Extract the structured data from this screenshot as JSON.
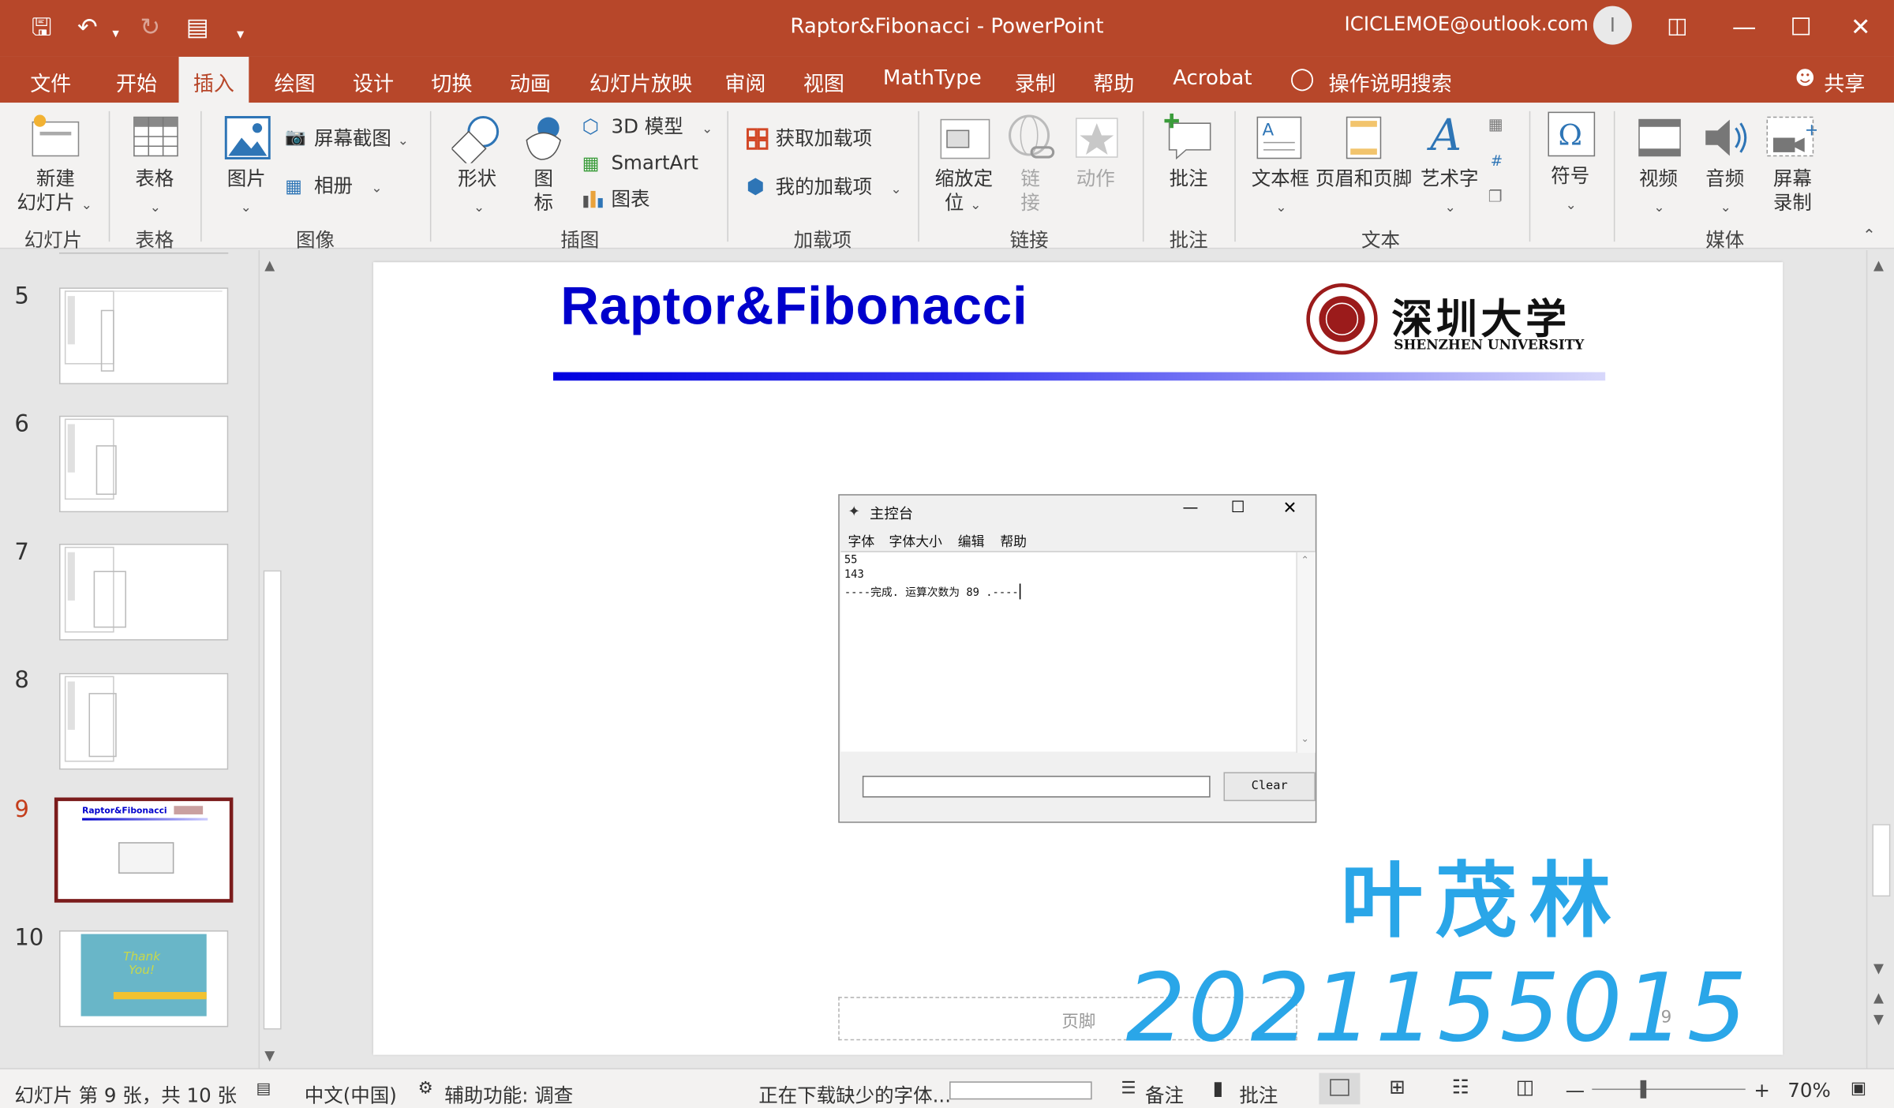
{
  "window": {
    "title": "Raptor&Fibonacci  -  PowerPoint",
    "account": "ICICLEMOE@outlook.com",
    "avatar": "I"
  },
  "tabs": [
    "文件",
    "开始",
    "插入",
    "绘图",
    "设计",
    "切换",
    "动画",
    "幻灯片放映",
    "审阅",
    "视图",
    "MathType",
    "录制",
    "帮助",
    "Acrobat",
    "操作说明搜索",
    "共享"
  ],
  "ribbon": {
    "new_slide": [
      "新建",
      "幻灯片"
    ],
    "table": "表格",
    "picture": "图片",
    "screenshot": "屏幕截图",
    "album": "相册",
    "shapes": "形状",
    "icons": [
      "图",
      "标"
    ],
    "model3d": "3D 模型",
    "smartart": "SmartArt",
    "chart": "图表",
    "get_addins": "获取加载项",
    "my_addins": "我的加载项",
    "zoom": [
      "缩放定",
      "位"
    ],
    "link": [
      "链",
      "接"
    ],
    "action": "动作",
    "comment": "批注",
    "textbox": "文本框",
    "header_footer": "页眉和页脚",
    "wordart": "艺术字",
    "symbol": "符号",
    "video": "视频",
    "audio": "音频",
    "screen_rec": [
      "屏幕",
      "录制"
    ],
    "groups": [
      "幻灯片",
      "表格",
      "图像",
      "插图",
      "加载项",
      "链接",
      "批注",
      "文本",
      "媒体"
    ]
  },
  "thumbnails": {
    "numbers": [
      "5",
      "6",
      "7",
      "8",
      "9",
      "10"
    ],
    "mini_title": "Raptor&Fibonacci",
    "thank": [
      "Thank",
      "You!"
    ]
  },
  "slide": {
    "title": "Raptor&Fibonacci",
    "uni_cn": "深圳大学",
    "uni_en": "SHENZHEN UNIVERSITY",
    "footer": "页脚",
    "page": "9",
    "sig_name": "叶茂林",
    "sig_id": "2021155015"
  },
  "raptor": {
    "title": "主控台",
    "menu": [
      "字体",
      "字体大小",
      "编辑",
      "帮助"
    ],
    "lines": [
      "55",
      "143",
      "----完成. 运算次数为 89 .----"
    ],
    "clear": "Clear"
  },
  "status": {
    "slide_info": "幻灯片 第 9 张，共 10 张",
    "lang": "中文(中国)",
    "access": "辅助功能: 调查",
    "download": "正在下载缺少的字体...",
    "notes": "备注",
    "comments": "批注",
    "zoom": "70%"
  }
}
